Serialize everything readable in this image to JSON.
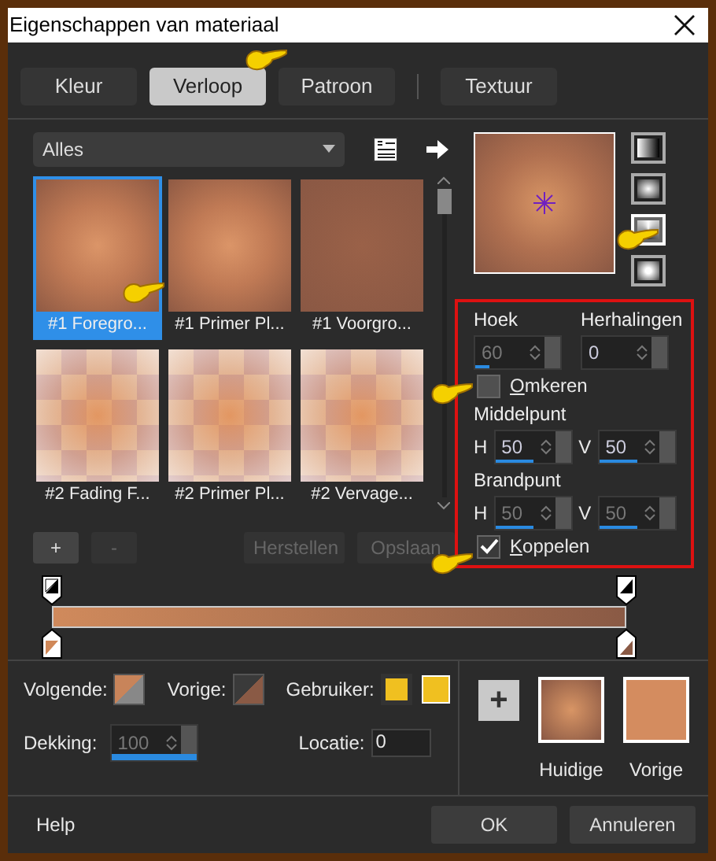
{
  "window": {
    "title": "Eigenschappen van materiaal"
  },
  "tabs": [
    {
      "label": "Kleur",
      "selected": false
    },
    {
      "label": "Verloop",
      "selected": true
    },
    {
      "label": "Patroon",
      "selected": false
    },
    {
      "label": "Textuur",
      "selected": false
    }
  ],
  "gradient_list": {
    "filter": "Alles",
    "items": [
      {
        "label": "#1 Foregro...",
        "selected": true,
        "kind": "radial"
      },
      {
        "label": "#1 Primer Pl...",
        "selected": false,
        "kind": "radial"
      },
      {
        "label": "#1 Voorgro...",
        "selected": false,
        "kind": "flat"
      },
      {
        "label": "#2 Fading F...",
        "selected": false,
        "kind": "checker"
      },
      {
        "label": "#2 Primer Pl...",
        "selected": false,
        "kind": "checker"
      },
      {
        "label": "#2 Vervage...",
        "selected": false,
        "kind": "checker"
      }
    ]
  },
  "style_buttons": [
    {
      "kind": "linear",
      "selected": false
    },
    {
      "kind": "rectangular",
      "selected": false
    },
    {
      "kind": "sunburst",
      "selected": true
    },
    {
      "kind": "radial",
      "selected": false
    }
  ],
  "settings": {
    "angle": {
      "label": "Hoek",
      "value": "60",
      "level": 0.17,
      "disabled": true
    },
    "repeats": {
      "label": "Herhalingen",
      "value": "0",
      "disabled": false
    },
    "invert": {
      "label": "Omkeren",
      "checked": false
    },
    "center": {
      "label": "Middelpunt",
      "fields": [
        {
          "axis": "H",
          "value": "50",
          "level": 0.5,
          "disabled": false
        },
        {
          "axis": "V",
          "value": "50",
          "level": 0.5,
          "disabled": false
        }
      ]
    },
    "focal": {
      "label": "Brandpunt",
      "fields": [
        {
          "axis": "H",
          "value": "50",
          "level": 0.5,
          "disabled": true
        },
        {
          "axis": "V",
          "value": "50",
          "level": 0.5,
          "disabled": true
        }
      ]
    },
    "link": {
      "label": "Koppelen",
      "checked": true
    }
  },
  "editor": {
    "buttons": [
      {
        "label": "+",
        "disabled": false
      },
      {
        "label": "-",
        "disabled": true
      },
      {
        "label": "Herstellen",
        "disabled": true
      },
      {
        "label": "Opslaan",
        "disabled": true
      }
    ]
  },
  "stop": {
    "next_label": "Volgende:",
    "prev_label": "Vorige:",
    "user_label": "Gebruiker:",
    "opacity": {
      "label": "Dekking:",
      "value": "100",
      "level": 1,
      "disabled": true
    },
    "location": {
      "label": "Locatie:",
      "value": "0"
    }
  },
  "swatches": {
    "add": "+",
    "items": [
      {
        "label": "Huidige",
        "kind": "gradient"
      },
      {
        "label": "Vorige",
        "kind": "solid"
      }
    ]
  },
  "footer": {
    "help": "Help",
    "buttons": [
      {
        "label": "OK"
      },
      {
        "label": "Annuleren"
      }
    ]
  }
}
